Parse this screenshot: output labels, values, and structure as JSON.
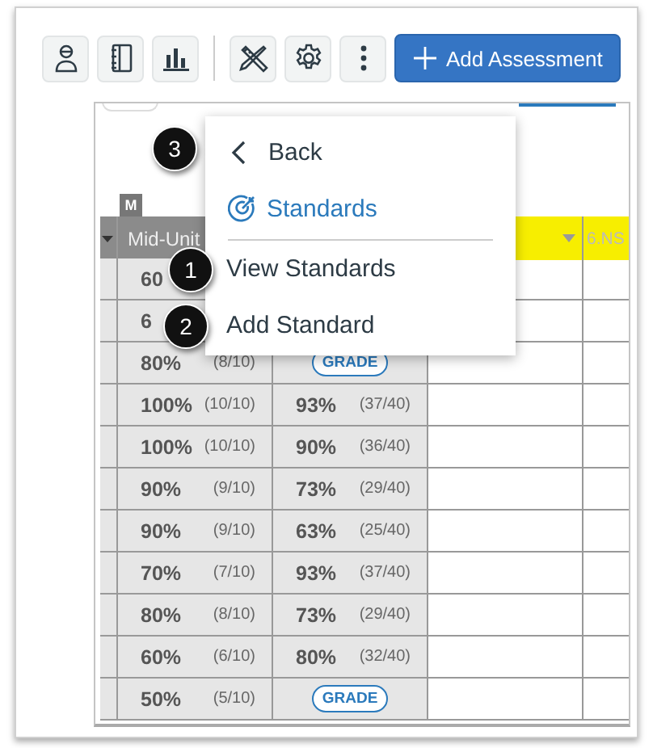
{
  "toolbar": {
    "primary_button": "Add Assessment"
  },
  "menu": {
    "back": {
      "label": "Back",
      "callout": "3"
    },
    "title": "Standards",
    "items": [
      {
        "label": "View Standards",
        "callout": "1"
      },
      {
        "label": "Add Standard",
        "callout": "2"
      }
    ]
  },
  "table": {
    "tag": "M",
    "columns": [
      {
        "label": "Mid-Unit",
        "highlighted": false
      },
      {
        "highlighted": true
      },
      {
        "label": "6.NS",
        "highlighted": true
      }
    ],
    "rows": [
      {
        "score": "60"
      },
      {
        "score": "6"
      },
      {
        "score": "80%",
        "fraction": "(8/10)",
        "result": {
          "kind": "grade",
          "label": "GRADE"
        }
      },
      {
        "score": "100%",
        "fraction": "(10/10)",
        "result": {
          "kind": "score",
          "percent": "93%",
          "fraction": "(37/40)"
        }
      },
      {
        "score": "100%",
        "fraction": "(10/10)",
        "result": {
          "kind": "score",
          "percent": "90%",
          "fraction": "(36/40)"
        }
      },
      {
        "score": "90%",
        "fraction": "(9/10)",
        "result": {
          "kind": "score",
          "percent": "73%",
          "fraction": "(29/40)"
        }
      },
      {
        "score": "90%",
        "fraction": "(9/10)",
        "result": {
          "kind": "score",
          "percent": "63%",
          "fraction": "(25/40)"
        }
      },
      {
        "score": "70%",
        "fraction": "(7/10)",
        "result": {
          "kind": "score",
          "percent": "93%",
          "fraction": "(37/40)"
        }
      },
      {
        "score": "80%",
        "fraction": "(8/10)",
        "result": {
          "kind": "score",
          "percent": "73%",
          "fraction": "(29/40)"
        }
      },
      {
        "score": "60%",
        "fraction": "(6/10)",
        "result": {
          "kind": "score",
          "percent": "80%",
          "fraction": "(32/40)"
        }
      },
      {
        "score": "50%",
        "fraction": "(5/10)",
        "result": {
          "kind": "grade",
          "label": "GRADE"
        }
      }
    ]
  }
}
